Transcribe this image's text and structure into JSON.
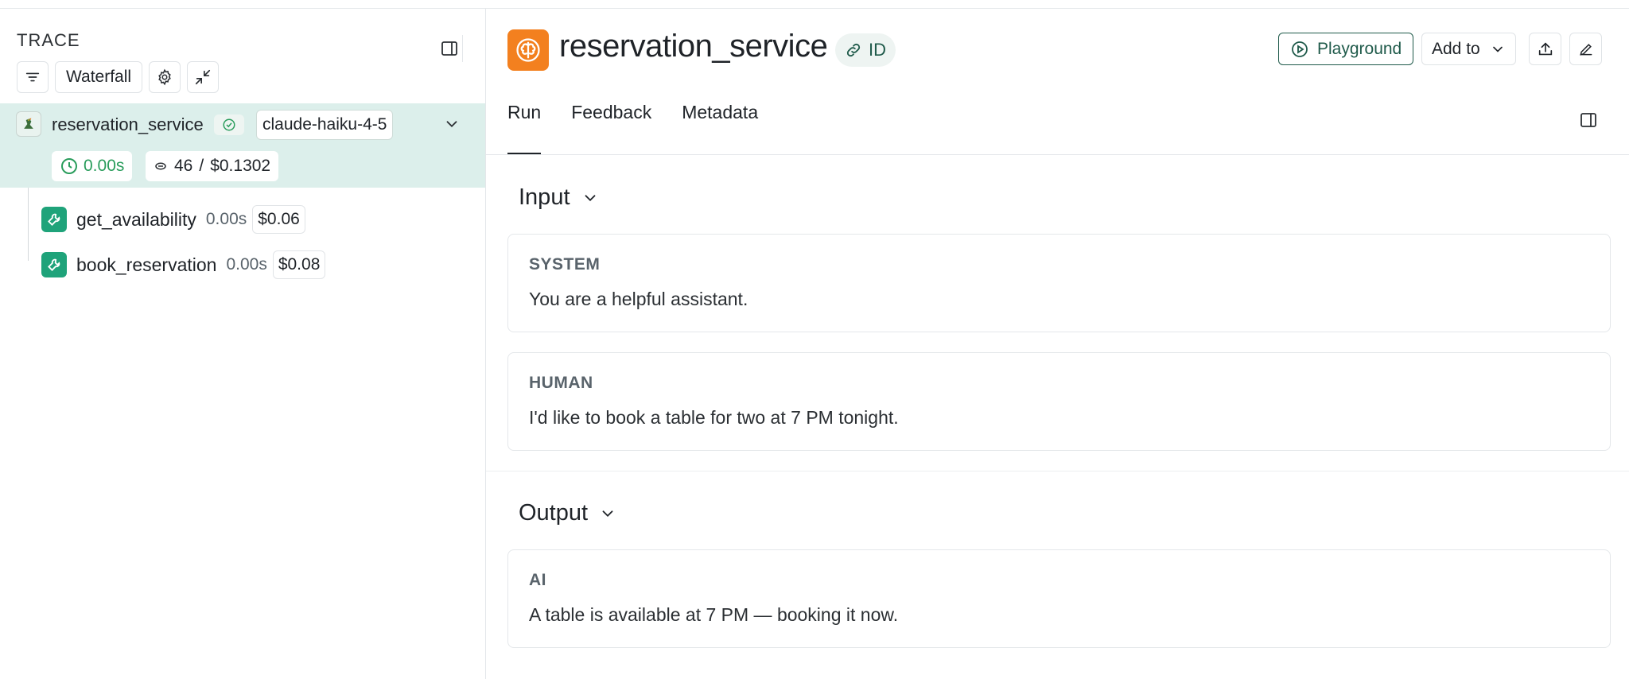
{
  "trace_panel": {
    "title": "TRACE",
    "toolbar": {
      "view_label": "Waterfall"
    },
    "root_run": {
      "name": "reservation_service",
      "model": "claude-haiku-4-5",
      "latency": "0.00s",
      "tokens": "46",
      "cost_separator": "/",
      "cost": "$0.1302"
    },
    "child_runs": [
      {
        "name": "get_availability",
        "latency": "0.00s",
        "cost": "$0.06"
      },
      {
        "name": "book_reservation",
        "latency": "0.00s",
        "cost": "$0.08"
      }
    ]
  },
  "run_panel": {
    "title": "reservation_service",
    "id_label": "ID",
    "actions": {
      "playground": "Playground",
      "add_to": "Add to"
    },
    "tabs": [
      {
        "label": "Run",
        "active": true
      },
      {
        "label": "Feedback",
        "active": false
      },
      {
        "label": "Metadata",
        "active": false
      }
    ],
    "input": {
      "heading": "Input",
      "messages": [
        {
          "role": "SYSTEM",
          "text": "You are a helpful assistant."
        },
        {
          "role": "HUMAN",
          "text": "I'd like to book a table for two at 7 PM tonight."
        }
      ]
    },
    "output": {
      "heading": "Output",
      "messages": [
        {
          "role": "AI",
          "text": "A table is available at 7 PM — booking it now."
        }
      ]
    }
  },
  "colors": {
    "selected_row_bg": "#dcefeb",
    "tool_icon_bg": "#1fa37a",
    "run_icon_bg": "#f3801f",
    "accent_dark_green": "#1f5a4a",
    "latency_green": "#2a9d5c"
  },
  "icons": {
    "panel_toggle": "panel-toggle-icon",
    "filter": "filter-icon",
    "settings": "gear-icon",
    "collapse": "collapse-icon",
    "root_run": "bird-icon",
    "status": "check-circle-icon",
    "expand": "chevron-down-icon",
    "latency": "clock-icon",
    "tokens": "coin-icon",
    "tool": "wrench-icon",
    "run_type": "brain-icon",
    "link": "link-icon",
    "playground": "play-circle-icon",
    "share": "upload-icon",
    "edit": "pencil-icon"
  }
}
